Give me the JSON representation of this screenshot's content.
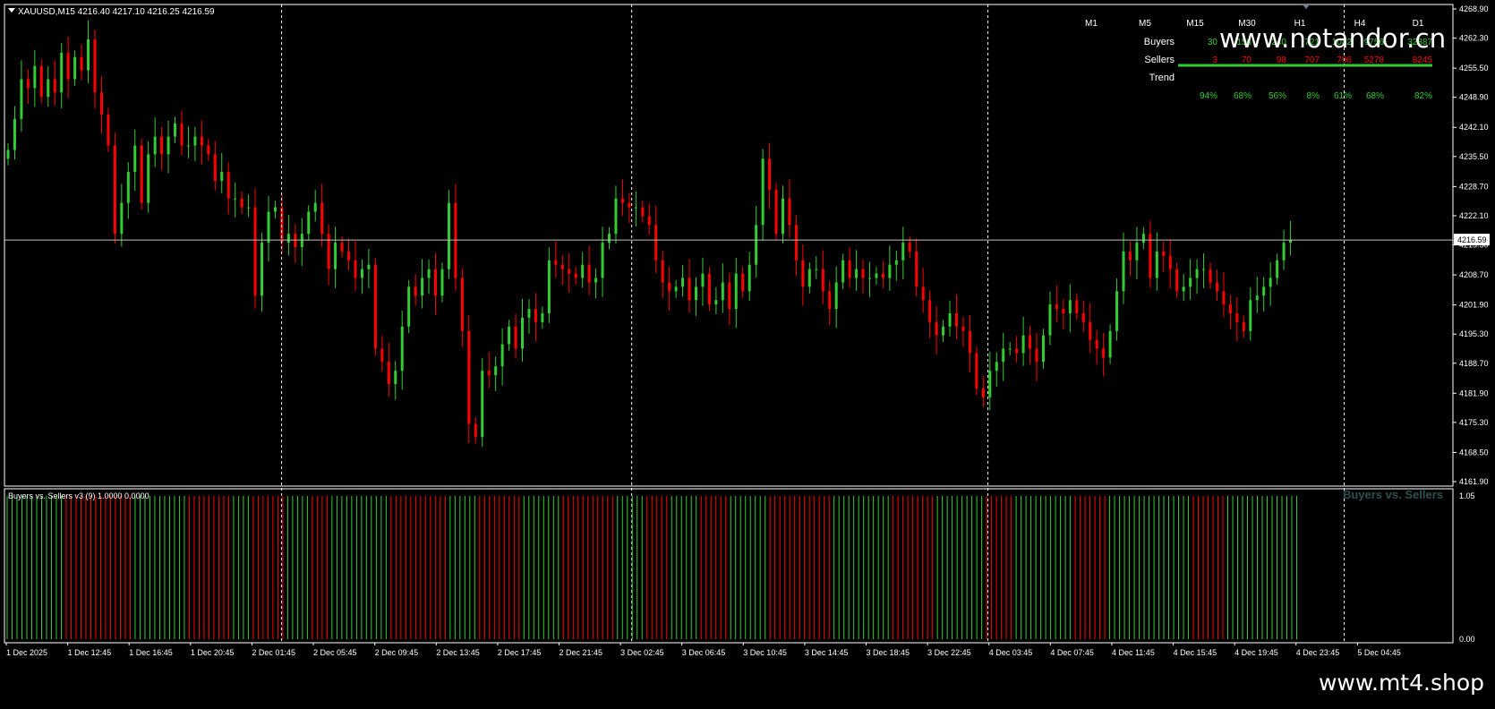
{
  "window": {
    "symbol_header": "XAUUSD,M15  4216.40 4217.10 4216.25 4216.59",
    "current_price_label": "4216.59"
  },
  "watermarks": {
    "top": "www.notandor.cn",
    "bottom": "www.mt4.shop"
  },
  "colors": {
    "background": "#000000",
    "bull": "#32cd32",
    "bear": "#ff0000",
    "frame": "#ffffff",
    "price_line": "#c0c0c0",
    "label_muted": "#2f4f4f"
  },
  "price_axis": {
    "min": 4161.9,
    "max": 4268.9,
    "tick_labels": [
      "4268.90",
      "4262.30",
      "4255.50",
      "4248.90",
      "4242.10",
      "4235.50",
      "4228.70",
      "4222.10",
      "4215.50",
      "4208.70",
      "4201.90",
      "4195.30",
      "4188.70",
      "4181.90",
      "4175.30",
      "4168.50",
      "4161.90"
    ],
    "tick_values": [
      4268.9,
      4262.3,
      4255.5,
      4248.9,
      4242.1,
      4235.5,
      4228.7,
      4222.1,
      4215.5,
      4208.7,
      4201.9,
      4195.3,
      4188.7,
      4181.9,
      4175.3,
      4168.5,
      4161.9
    ],
    "current_price": 4216.59
  },
  "time_axis": {
    "labels": [
      "1 Dec 2025",
      "1 Dec 12:45",
      "1 Dec 16:45",
      "1 Dec 20:45",
      "2 Dec 01:45",
      "2 Dec 05:45",
      "2 Dec 09:45",
      "2 Dec 13:45",
      "2 Dec 17:45",
      "2 Dec 21:45",
      "3 Dec 02:45",
      "3 Dec 06:45",
      "3 Dec 10:45",
      "3 Dec 14:45",
      "3 Dec 18:45",
      "3 Dec 22:45",
      "4 Dec 03:45",
      "4 Dec 07:45",
      "4 Dec 11:45",
      "4 Dec 15:45",
      "4 Dec 19:45",
      "4 Dec 23:45",
      "5 Dec 04:45"
    ],
    "day_separator_indices": [
      3.8,
      9.5,
      15.3,
      21.1
    ]
  },
  "indicator": {
    "header": "Buyers vs. Sellers v3 (9) 1.0000 0.0000",
    "title": "Buyers vs. Sellers",
    "axis_top": "1.05",
    "axis_bottom": "0.00"
  },
  "dashboard": {
    "timeframes": [
      "M1",
      "M5",
      "M15",
      "M30",
      "H1",
      "H4",
      "D1"
    ],
    "buyers_label": "Buyers",
    "sellers_label": "Sellers",
    "trend_label": "Trend",
    "buyers": [
      "30",
      "156",
      "240",
      "721",
      "1082",
      "9756",
      "32887"
    ],
    "sellers": [
      "3",
      "70",
      "98",
      "707",
      "706",
      "5278",
      "8245"
    ],
    "trend": [
      "94%",
      "68%",
      "56%",
      "8%",
      "61%",
      "68%",
      "82%"
    ]
  },
  "chart_data": {
    "type": "candlestick",
    "title": "XAUUSD,M15",
    "ylim": [
      4161.9,
      4268.9
    ],
    "close": [
      4237,
      4244,
      4253,
      4251,
      4256,
      4249,
      4253,
      4250,
      4259,
      4253,
      4258,
      4255,
      4262,
      4250,
      4245,
      4238,
      4218,
      4225,
      4232,
      4238,
      4225,
      4236,
      4240,
      4236,
      4240,
      4243,
      4238,
      4238,
      4240,
      4238,
      4236,
      4230,
      4232,
      4226,
      4226,
      4224,
      4224,
      4204,
      4216,
      4223,
      4224,
      4216,
      4218,
      4215,
      4218,
      4223,
      4225,
      4218,
      4210,
      4216,
      4214,
      4212,
      4208,
      4210,
      4211,
      4192,
      4189,
      4184,
      4187,
      4197,
      4206,
      4204,
      4208,
      4210,
      4204,
      4210,
      4225,
      4208,
      4196,
      4175,
      4172,
      4187,
      4186,
      4188,
      4193,
      4197,
      4192,
      4199,
      4201,
      4198,
      4200,
      4212,
      4211,
      4210,
      4209,
      4208,
      4211,
      4207,
      4208,
      4216,
      4218,
      4226,
      4225,
      4224,
      4224,
      4222,
      4220,
      4212,
      4207,
      4205,
      4206,
      4208,
      4203,
      4206,
      4209,
      4202,
      4203,
      4207,
      4201,
      4209,
      4205,
      4211,
      4220,
      4235,
      4228,
      4218,
      4226,
      4220,
      4212,
      4206,
      4210,
      4210,
      4205,
      4201,
      4207,
      4212,
      4208,
      4210,
      4208,
      4208,
      4209,
      4208,
      4211,
      4212,
      4216,
      4214,
      4206,
      4203,
      4198,
      4195,
      4197,
      4200,
      4197,
      4196,
      4191,
      4183,
      4181,
      4187,
      4189,
      4192,
      4192,
      4191,
      4195,
      4192,
      4189,
      4195,
      4202,
      4201,
      4200,
      4203,
      4200,
      4198,
      4194,
      4192,
      4190,
      4196,
      4205,
      4214,
      4212,
      4216,
      4218,
      4208,
      4214,
      4213,
      4210,
      4205,
      4206,
      4208,
      4210,
      4210,
      4207,
      4205,
      4202,
      4200,
      4198,
      4196,
      4203,
      4204,
      4206,
      4208,
      4212,
      4216,
      4216.59
    ],
    "open_offsets": [
      -2,
      2,
      -3,
      3,
      -2,
      3,
      -2,
      4,
      -3,
      3,
      -2,
      4,
      -5,
      -4,
      -6,
      -8,
      5,
      4,
      4,
      -5,
      6,
      3,
      -3,
      2,
      2,
      -4,
      1,
      1,
      -1,
      -2,
      -3,
      1,
      -4,
      -2,
      1,
      -1,
      -12,
      7,
      4,
      2,
      -4,
      1,
      -2,
      2,
      3,
      1,
      -3,
      -5,
      3,
      -1,
      -2,
      -3,
      2,
      1,
      -10,
      -3,
      -3,
      2,
      5,
      5,
      -1,
      2,
      2,
      -4,
      3,
      8,
      -9,
      -8,
      -10,
      -3,
      8,
      -1,
      1,
      3,
      2,
      -3,
      4,
      2,
      -2,
      1,
      6,
      -1,
      -1,
      -1,
      -1,
      2,
      -2,
      1,
      4,
      2,
      4,
      -1,
      -1,
      -1,
      -1,
      -1,
      -5,
      -3,
      -2,
      1,
      1,
      -3,
      2,
      2,
      -4,
      1,
      2,
      -3,
      4,
      -2,
      3,
      5,
      8,
      -4,
      -6,
      5,
      -3,
      -5,
      -3,
      2,
      1,
      -3,
      -2,
      3,
      3,
      -2,
      1,
      -1,
      1,
      1,
      -1,
      2,
      1,
      2,
      -1,
      -4,
      -2,
      -3,
      -2,
      1,
      2,
      -2,
      -1,
      -3,
      -4,
      -2,
      3,
      1,
      2,
      1,
      -1,
      2,
      -2,
      -2,
      3,
      4,
      -1,
      -1,
      2,
      -2,
      -1,
      -2,
      -1,
      -1,
      3,
      5,
      5,
      -1,
      2,
      1,
      -5,
      3,
      -1,
      -2,
      -3,
      1,
      1,
      1,
      1,
      -2,
      -1,
      -2,
      -1,
      -1,
      -1,
      4,
      1,
      1,
      1,
      2,
      2,
      1,
      1
    ],
    "bvs_pattern": "ggggggggggggrrrrrrrrrrrrrrgggggggggggrrrrrrrrrggggrrrrrrrgggggrrrrggggggggggggrrrrrrrrrrrrggggggrrrrrrrrrggggggggrrrrrrrrrrrggggggrrrrrggggggrrrrrrggggggggrrrrrrrrrrrrrggggggggggggrrrrrrrrrggggggggggrrrrrrggggggggggggrrrrrrrgggggggggggggggggrrrrrrrggggggggggggggg"
  }
}
